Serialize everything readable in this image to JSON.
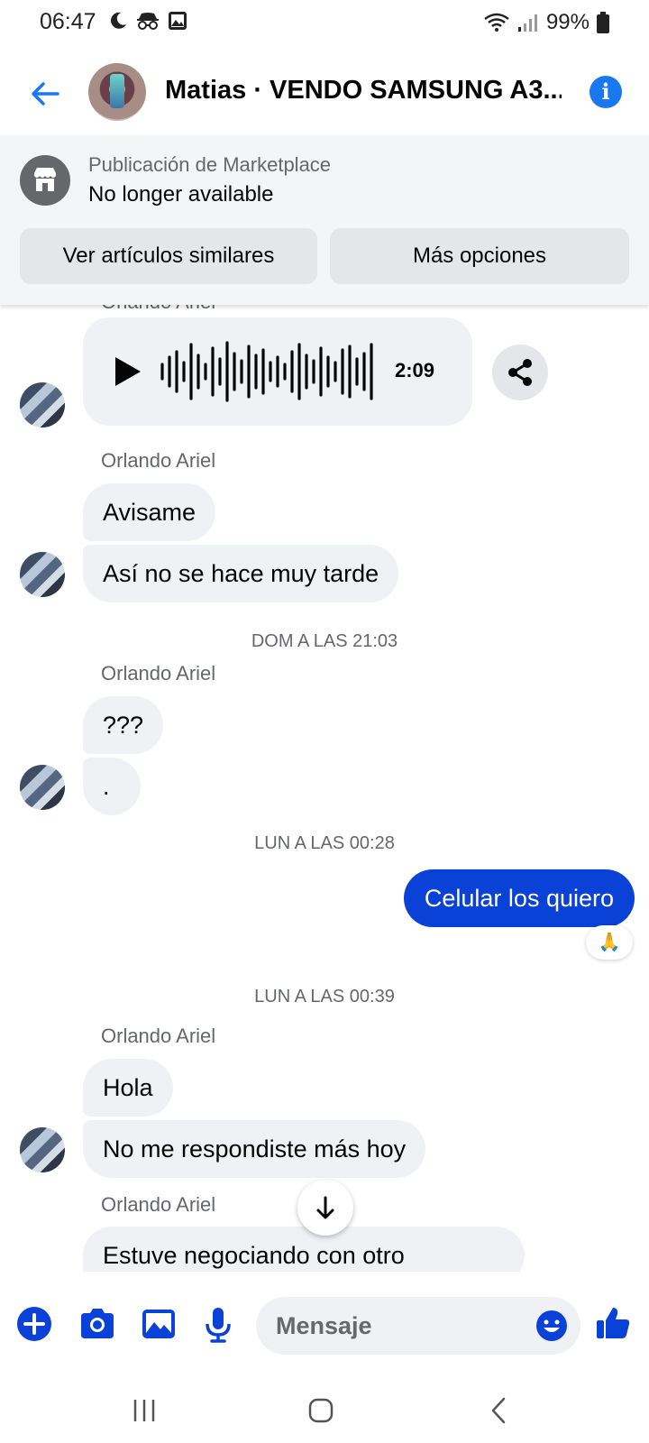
{
  "status_bar": {
    "time": "06:47",
    "battery": "99%"
  },
  "header": {
    "title": "Matias · VENDO SAMSUNG A3..."
  },
  "marketplace": {
    "label": "Publicación de Marketplace",
    "status": "No longer available",
    "btn_similar": "Ver artículos similares",
    "btn_more": "Más opciones"
  },
  "chat": {
    "sender_cut": "Orlando Ariel",
    "audio_duration": "2:09",
    "group1": {
      "sender": "Orlando Ariel",
      "msg1": "Avisame",
      "msg2": "Así no se hace muy tarde"
    },
    "sep1": "DOM A LAS 21:03",
    "group2": {
      "sender": "Orlando Ariel",
      "msg1": "???",
      "msg2": "."
    },
    "sep2": "LUN A LAS 00:28",
    "outgoing": "Celular los quiero",
    "reaction": "🙏",
    "sep3": "LUN A LAS 00:39",
    "group3": {
      "sender": "Orlando Ariel",
      "msg1": "Hola",
      "msg2": "No me respondiste más hoy"
    },
    "group4": {
      "sender": "Orlando Ariel",
      "msg1": "Estuve negociando con otro"
    }
  },
  "composer": {
    "placeholder": "Mensaje"
  },
  "colors": {
    "accent": "#0a42d8",
    "link_blue": "#1977f2",
    "bubble_in": "#f0f1f4"
  },
  "icons": [
    "back-arrow-icon",
    "info-icon",
    "store-icon",
    "play-icon",
    "share-icon",
    "plus-icon",
    "camera-icon",
    "image-icon",
    "mic-icon",
    "emoji-icon",
    "thumbs-up-icon",
    "arrow-down-icon",
    "recents-icon",
    "home-icon",
    "nav-back-icon"
  ]
}
